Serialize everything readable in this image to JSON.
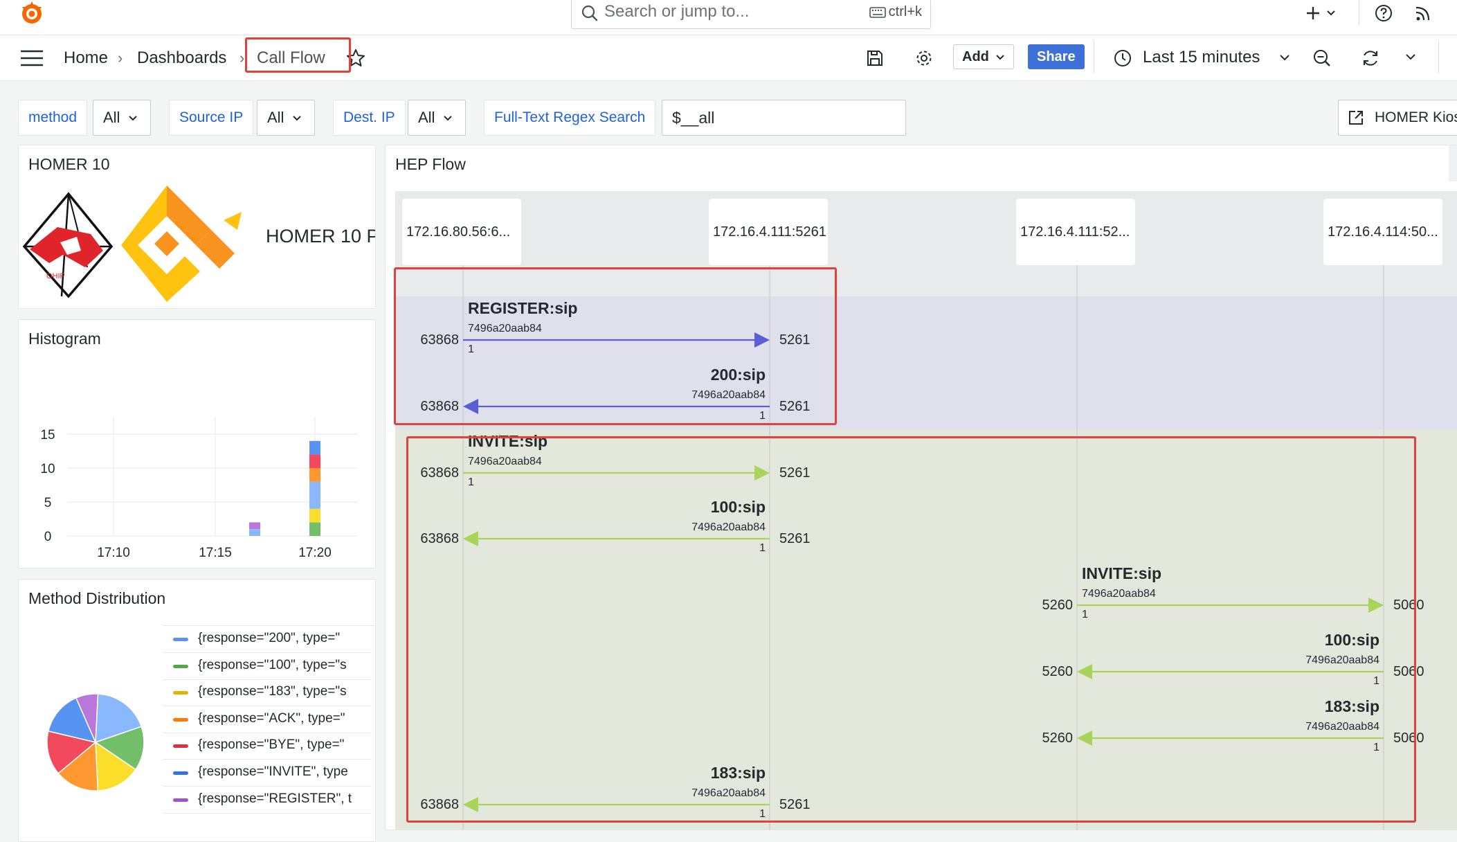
{
  "top": {
    "search_placeholder": "Search or jump to...",
    "search_shortcut": "ctrl+k"
  },
  "nav": {
    "breadcrumbs": [
      "Home",
      "Dashboards",
      "Call Flow"
    ],
    "add_label": "Add",
    "share_label": "Share",
    "time_range": "Last 15 minutes"
  },
  "variables": [
    {
      "label": "method",
      "value": "All"
    },
    {
      "label": "Source IP",
      "value": "All"
    },
    {
      "label": "Dest. IP",
      "value": "All"
    }
  ],
  "search_var": {
    "label": "Full-Text Regex Search",
    "value": "$__all"
  },
  "kiosk_label": "HOMER Kiosk",
  "homer_panel": {
    "title": "HOMER 10",
    "text": "HOMER 10 P"
  },
  "histogram": {
    "title": "Histogram"
  },
  "chart_data": {
    "type": "bar",
    "title": "Histogram",
    "x_ticks": [
      "17:10",
      "17:15",
      "17:20"
    ],
    "y_ticks": [
      0,
      5,
      10,
      15
    ],
    "ylim": [
      0,
      15
    ],
    "stacked": true,
    "bars": [
      {
        "x": "17:17",
        "segments": [
          {
            "color": "#8ab8ff",
            "value": 1
          },
          {
            "color": "#b877d9",
            "value": 1
          }
        ]
      },
      {
        "x": "17:20",
        "segments": [
          {
            "color": "#73bf69",
            "value": 2
          },
          {
            "color": "#fade2a",
            "value": 2
          },
          {
            "color": "#8ab8ff",
            "value": 4
          },
          {
            "color": "#ff9830",
            "value": 2
          },
          {
            "color": "#f2495c",
            "value": 2
          },
          {
            "color": "#5794f2",
            "value": 2
          }
        ]
      }
    ]
  },
  "method_distribution": {
    "title": "Method Distribution",
    "legend": [
      {
        "label": "{response=\"200\", type=\"",
        "color": "#5794f2"
      },
      {
        "label": "{response=\"100\", type=\"s",
        "color": "#56a64b"
      },
      {
        "label": "{response=\"183\", type=\"s",
        "color": "#e0b400"
      },
      {
        "label": "{response=\"ACK\", type=\"",
        "color": "#ff780a"
      },
      {
        "label": "{response=\"BYE\", type=\"",
        "color": "#e02f44"
      },
      {
        "label": "{response=\"INVITE\", type",
        "color": "#3274d9"
      },
      {
        "label": "{response=\"REGISTER\", t",
        "color": "#a352cc"
      }
    ],
    "pie": [
      {
        "value": 18,
        "color": "#8ab8ff"
      },
      {
        "value": 14,
        "color": "#73bf69"
      },
      {
        "value": 14,
        "color": "#fade2a"
      },
      {
        "value": 14,
        "color": "#ff9830"
      },
      {
        "value": 14,
        "color": "#f2495c"
      },
      {
        "value": 14,
        "color": "#5794f2"
      },
      {
        "value": 7,
        "color": "#b877d9"
      }
    ]
  },
  "hep_flow": {
    "title": "HEP Flow",
    "columns": [
      "172.16.80.56:6...",
      "172.16.4.111:5261",
      "172.16.4.111:52...",
      "172.16.4.114:50..."
    ],
    "messages": [
      {
        "title": "REGISTER:sip",
        "id": "7496a20aab84",
        "num": "1",
        "from": "63868",
        "to": "5261",
        "dir": "right",
        "color": "#5b5fd6"
      },
      {
        "title": "200:sip",
        "id": "7496a20aab84",
        "num": "1",
        "from": "63868",
        "to": "5261",
        "dir": "left",
        "color": "#5b5fd6"
      },
      {
        "title": "INVITE:sip",
        "id": "7496a20aab84",
        "num": "1",
        "from": "63868",
        "to": "5261",
        "dir": "right",
        "color": "#a8d459"
      },
      {
        "title": "100:sip",
        "id": "7496a20aab84",
        "num": "1",
        "from": "63868",
        "to": "5261",
        "dir": "left",
        "color": "#a8d459"
      },
      {
        "title": "INVITE:sip",
        "id": "7496a20aab84",
        "num": "1",
        "from": "5260",
        "to": "5060",
        "dir": "right",
        "color": "#a8d459"
      },
      {
        "title": "100:sip",
        "id": "7496a20aab84",
        "num": "1",
        "from": "5260",
        "to": "5060",
        "dir": "left",
        "color": "#a8d459"
      },
      {
        "title": "183:sip",
        "id": "7496a20aab84",
        "num": "1",
        "from": "5260",
        "to": "5060",
        "dir": "left",
        "color": "#a8d459"
      },
      {
        "title": "183:sip",
        "id": "7496a20aab84",
        "num": "1",
        "from": "63868",
        "to": "5261",
        "dir": "left",
        "color": "#a8d459"
      }
    ]
  }
}
